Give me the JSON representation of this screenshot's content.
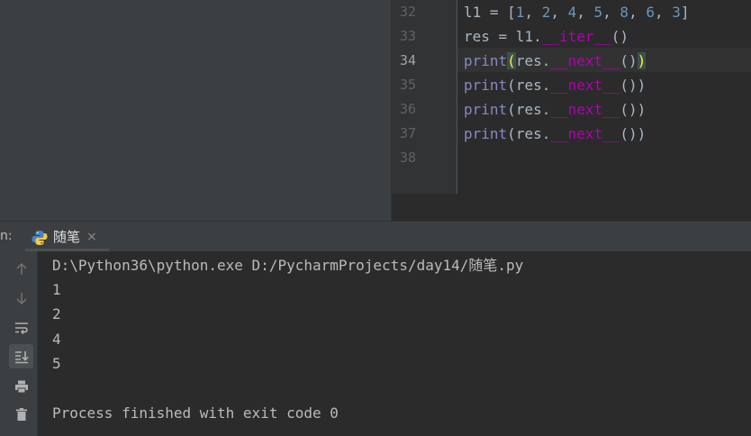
{
  "editor": {
    "line_numbers": [
      "32",
      "33",
      "34",
      "35",
      "36",
      "37",
      "38"
    ],
    "line32": {
      "var": "l1",
      "op": " = [",
      "n1": "1",
      "n2": "2",
      "n3": "4",
      "n4": "5",
      "n5": "8",
      "n6": "6",
      "n7": "3",
      "sep": ", ",
      "close": "]"
    },
    "line33": {
      "prefix": "res = l1.",
      "method": "__iter__",
      "suffix": "()"
    },
    "print_fn": "print",
    "paren_open": "(",
    "paren_close": ")",
    "next_prefix": "res.",
    "next_method": "__next__",
    "next_call": "()"
  },
  "run_panel": {
    "label": "n:",
    "tab_title": "随笔",
    "tab_close": "×"
  },
  "console": {
    "command": "D:\\Python36\\python.exe D:/PycharmProjects/day14/随笔.py",
    "outputs": [
      "1",
      "2",
      "4",
      "5"
    ],
    "exit_message": "Process finished with exit code 0"
  },
  "icons": {
    "up": "arrow-up-icon",
    "down": "arrow-down-icon",
    "wrap": "soft-wrap-icon",
    "scroll": "scroll-to-end-icon",
    "print": "print-icon",
    "delete": "trash-icon"
  }
}
